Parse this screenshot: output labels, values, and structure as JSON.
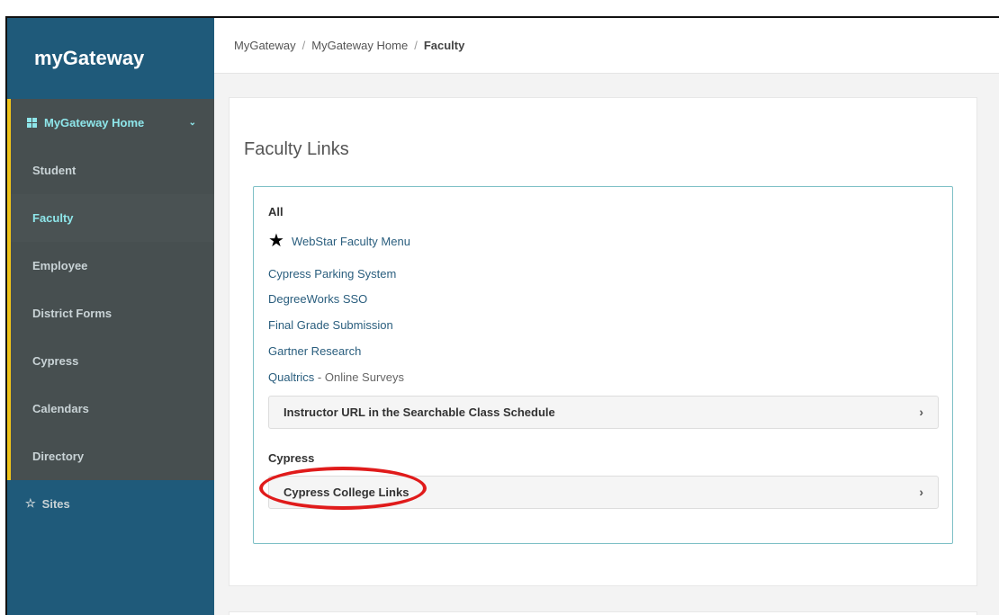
{
  "sidebar": {
    "brand": "myGateway",
    "items": [
      {
        "label": "MyGateway Home"
      },
      {
        "label": "Student"
      },
      {
        "label": "Faculty"
      },
      {
        "label": "Employee"
      },
      {
        "label": "District Forms"
      },
      {
        "label": "Cypress"
      },
      {
        "label": "Calendars"
      },
      {
        "label": "Directory"
      }
    ],
    "sites_label": "Sites"
  },
  "breadcrumb": {
    "items": [
      "MyGateway",
      "MyGateway Home",
      "Faculty"
    ],
    "separator": "/"
  },
  "main": {
    "title": "Faculty Links",
    "all_section": {
      "label": "All",
      "starred_link": "WebStar Faculty Menu",
      "links": [
        "Cypress Parking System",
        "DegreeWorks SSO",
        "Final Grade Submission",
        "Gartner Research"
      ],
      "qualtrics_link": "Qualtrics",
      "qualtrics_suffix": " - Online Surveys",
      "accordion": "Instructor URL in the Searchable Class Schedule"
    },
    "cypress_section": {
      "label": "Cypress",
      "accordion": "Cypress College Links"
    }
  },
  "colors": {
    "sidebar_bg": "#1f5a7a",
    "nav_bg": "#474f50",
    "accent_yellow": "#f0c419",
    "active_text": "#8ee6ea",
    "link": "#2a5e7e",
    "highlight_circle": "#e01b1b"
  }
}
